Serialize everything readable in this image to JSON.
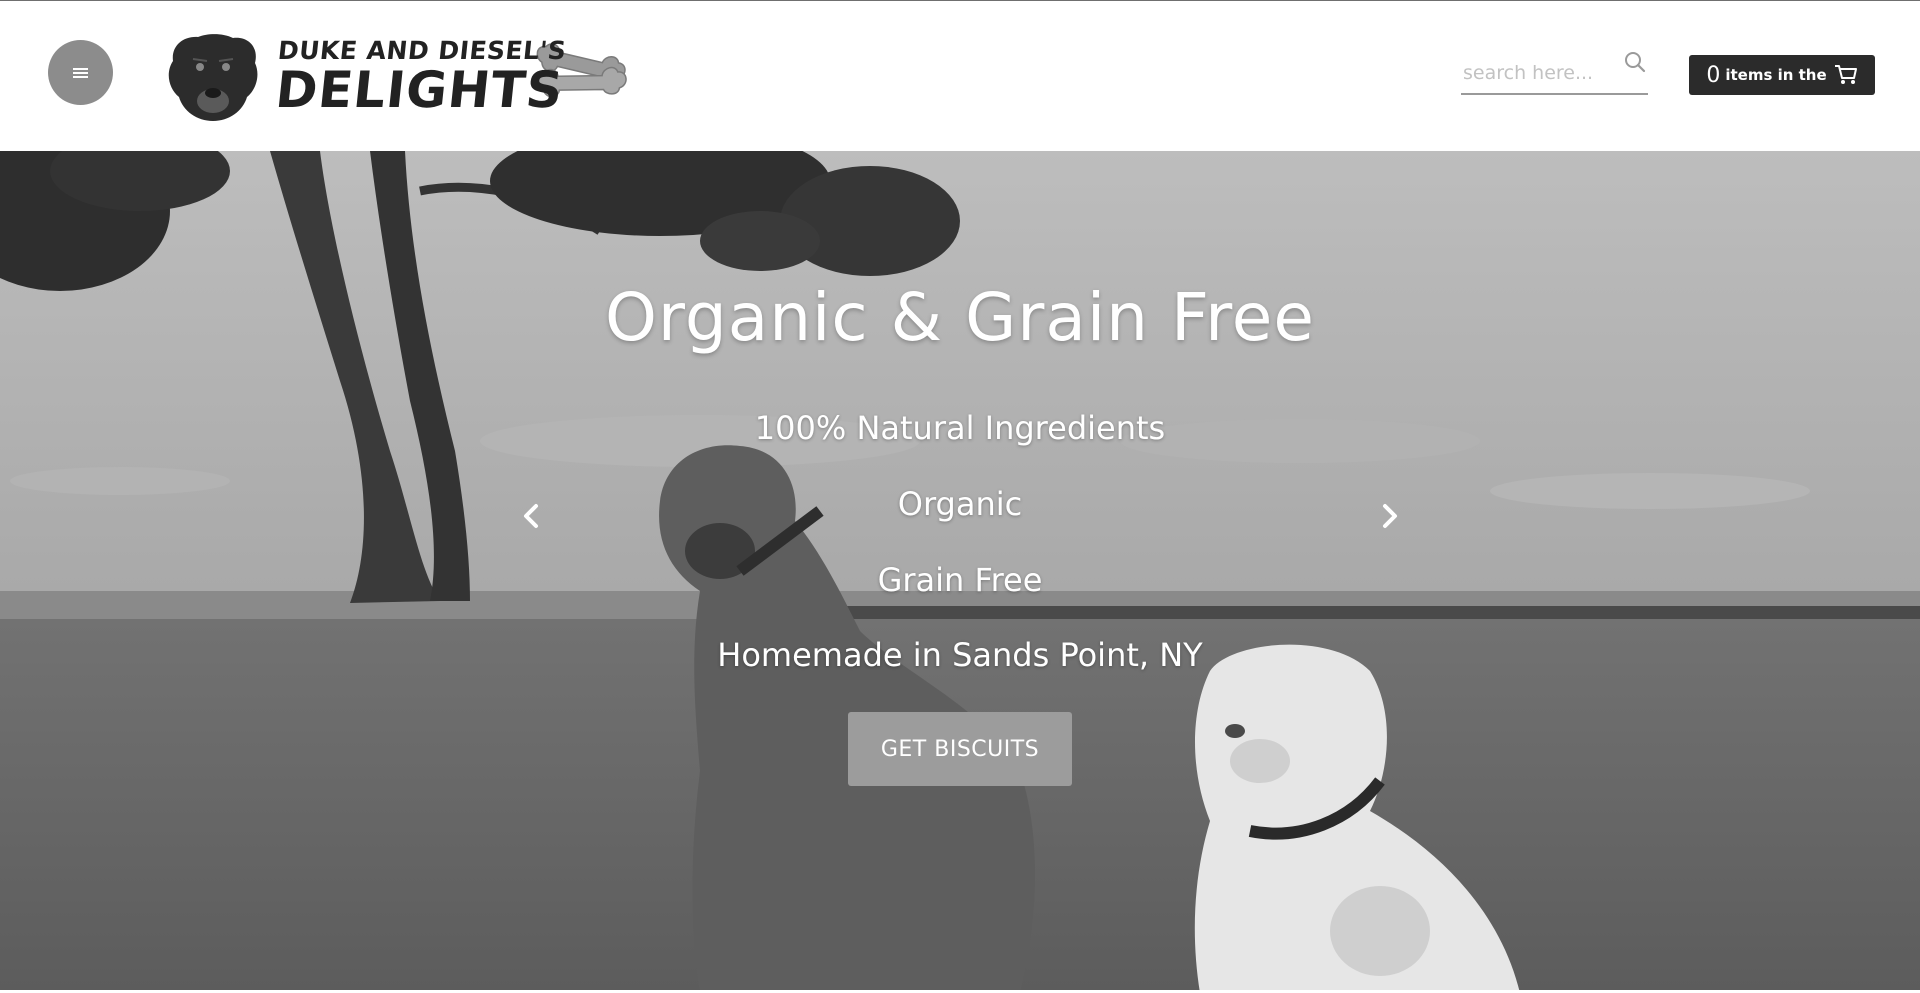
{
  "header": {
    "logo": {
      "line1": "DUKE AND DIESEL'S",
      "line2": "DELIGHTS"
    },
    "search": {
      "placeholder": "search here...",
      "value": ""
    },
    "cart": {
      "count": "0",
      "label": "items in the"
    }
  },
  "hero": {
    "headline": "Organic & Grain Free",
    "lines": [
      "100% Natural Ingredients",
      "Organic",
      "Grain Free",
      "Homemade in Sands Point, NY"
    ],
    "cta_label": "GET BISCUITS"
  },
  "icons": {
    "menu": "hamburger-menu-icon",
    "search": "search-icon",
    "cart": "shopping-cart-icon",
    "prev": "chevron-left-icon",
    "next": "chevron-right-icon"
  },
  "colors": {
    "cart_background": "#2b2b2b",
    "menu_button": "#8c8c8c",
    "cta_background": "#9c9c9c",
    "text_on_hero": "#ffffff"
  }
}
